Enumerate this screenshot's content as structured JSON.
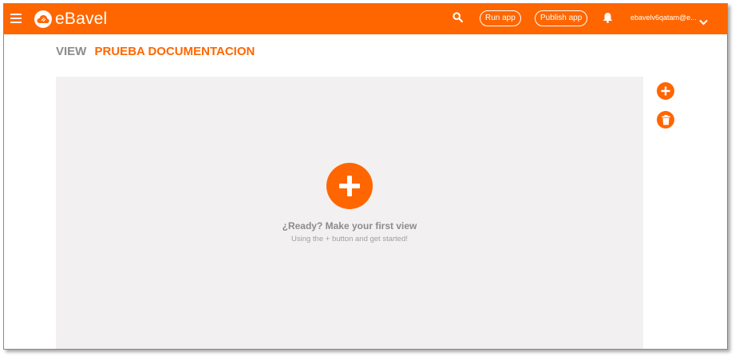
{
  "colors": {
    "accent": "#ff6600",
    "canvas_bg": "#f2f0f0",
    "title_gray": "#8c8c8c",
    "empty_title": "#8c8c8c",
    "empty_sub": "#a0a0a0"
  },
  "header": {
    "menu_icon": "hamburger-icon",
    "logo_text": "eBavel",
    "search_icon": "search-icon",
    "run_app_label": "Run app",
    "publish_app_label": "Publish app",
    "notifications_icon": "bell-icon",
    "user_email": "ebavelv6qatam@e...",
    "user_menu_icon": "chevron-down-icon"
  },
  "page": {
    "view_label": "VIEW",
    "view_name": "PRUEBA DOCUMENTACION"
  },
  "empty_state": {
    "add_icon": "plus-circle-icon",
    "title": "¿Ready? Make your first view",
    "subtitle": "Using the + button and get started!"
  },
  "side_actions": {
    "add_icon": "plus-circle-icon",
    "delete_icon": "trash-icon"
  }
}
